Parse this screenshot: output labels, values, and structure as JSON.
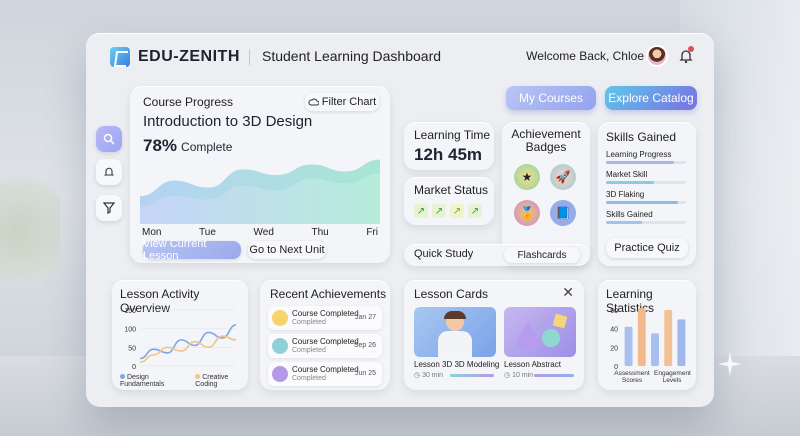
{
  "header": {
    "brand": "EDU-ZENITH",
    "app_title": "Student Learning Dashboard",
    "welcome": "Welcome Back, Chloe"
  },
  "top_actions": {
    "my_courses": "My Courses",
    "explore": "Explore Catalog"
  },
  "course_progress": {
    "title": "Course Progress",
    "filter_label": "Filter Chart",
    "course_name": "Introduction to 3D Design",
    "percent": "78%",
    "percent_suffix": "Complete",
    "days": [
      "Mon",
      "Tue",
      "Wed",
      "Thu",
      "Fri"
    ],
    "view_lesson": "View Current Lesson",
    "next_unit": "Go to Next Unit"
  },
  "learning_time": {
    "title": "Learning Time",
    "value": "12h 45m"
  },
  "market_status": {
    "title": "Market Status"
  },
  "achievement_badges": {
    "title_line1": "Achievement",
    "title_line2": "Badges"
  },
  "skills": {
    "title": "Skills Gained",
    "items": [
      {
        "label": "Learning Progress",
        "value": 0.85
      },
      {
        "label": "Market Skill",
        "value": 0.6
      },
      {
        "label": "3D Flaking",
        "value": 0.9
      },
      {
        "label": "Skills Gained",
        "value": 0.45
      }
    ],
    "practice_quiz": "Practice Quiz"
  },
  "quick_study": {
    "label": "Quick Study",
    "flashcards": "Flashcards"
  },
  "lesson_activity": {
    "title": "Lesson Activity Overview",
    "legend": [
      "Design Fundamentals",
      "Creative Coding"
    ]
  },
  "recent_achievements": {
    "title": "Recent Achievements",
    "items": [
      {
        "title": "Course Completed",
        "status": "Completed",
        "date": "Jan 27",
        "color": "#f4d46b"
      },
      {
        "title": "Course Completed",
        "status": "Completed",
        "date": "Sep 26",
        "color": "#8fd0d6"
      },
      {
        "title": "Course Completed",
        "status": "Completed",
        "date": "Jun 25",
        "color": "#b49ae6"
      }
    ]
  },
  "lesson_cards": {
    "title": "Lesson Cards",
    "cards": [
      {
        "title": "Lesson 3D 3D Modeling",
        "duration": "30 min"
      },
      {
        "title": "Lesson Abstract",
        "duration": "10 min"
      }
    ]
  },
  "chart_data": [
    {
      "type": "area",
      "x": [
        "Mon",
        "Tue",
        "Wed",
        "Thu",
        "Fri"
      ],
      "series": [
        {
          "values": [
            40,
            62,
            52,
            78,
            70,
            85,
            75,
            92
          ]
        },
        {
          "values": [
            25,
            40,
            35,
            55,
            48,
            65,
            58,
            72
          ]
        }
      ]
    },
    {
      "type": "line",
      "title": "Lesson Activity Overview",
      "yticks": [
        "150",
        "100",
        "50",
        "0"
      ],
      "ylim": [
        0,
        150
      ],
      "series": [
        {
          "name": "Design Fundamentals",
          "values": [
            20,
            45,
            35,
            70,
            55,
            90,
            75,
            110
          ]
        },
        {
          "name": "Creative Coding",
          "values": [
            10,
            30,
            50,
            40,
            65,
            50,
            80,
            70
          ]
        }
      ]
    },
    {
      "type": "bar",
      "title": "Learning Statistics",
      "categories": [
        "Assessment Scores",
        "Engagement Levels"
      ],
      "yticks": [
        "60",
        "40",
        "20",
        "0"
      ],
      "ylim": [
        0,
        60
      ],
      "series": [
        {
          "values": [
            42,
            62,
            35,
            60,
            50
          ]
        }
      ]
    }
  ]
}
